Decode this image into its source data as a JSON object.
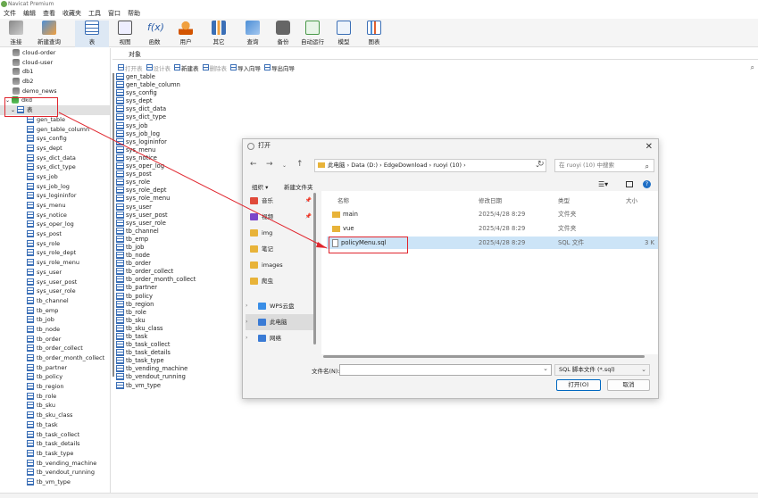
{
  "app": {
    "title": "Navicat Premium"
  },
  "menu": [
    "文件",
    "编辑",
    "查看",
    "收藏夹",
    "工具",
    "窗口",
    "帮助"
  ],
  "toolbar": {
    "buttons": [
      {
        "label": "连接",
        "icon": "plug-icon"
      },
      {
        "label": "新建查询",
        "icon": "new-query-icon"
      },
      {
        "label": "表",
        "icon": "table-icon"
      },
      {
        "label": "视图",
        "icon": "view-icon"
      },
      {
        "label": "函数",
        "icon": "function-icon"
      },
      {
        "label": "用户",
        "icon": "user-icon"
      },
      {
        "label": "其它",
        "icon": "tools-icon"
      },
      {
        "label": "查询",
        "icon": "query-icon"
      },
      {
        "label": "备份",
        "icon": "backup-icon"
      },
      {
        "label": "自动运行",
        "icon": "schedule-icon"
      },
      {
        "label": "模型",
        "icon": "model-icon"
      },
      {
        "label": "图表",
        "icon": "chart-icon"
      }
    ]
  },
  "sidebar": {
    "databases_top": [
      "cloud-order",
      "cloud-user",
      "db1",
      "db2",
      "demo_news"
    ],
    "active_db": "dkd",
    "tables_node": "表",
    "tables": [
      "gen_table",
      "gen_table_column",
      "sys_config",
      "sys_dept",
      "sys_dict_data",
      "sys_dict_type",
      "sys_job",
      "sys_job_log",
      "sys_logininfor",
      "sys_menu",
      "sys_notice",
      "sys_oper_log",
      "sys_post",
      "sys_role",
      "sys_role_dept",
      "sys_role_menu",
      "sys_user",
      "sys_user_post",
      "sys_user_role",
      "tb_channel",
      "tb_emp",
      "tb_job",
      "tb_node",
      "tb_order",
      "tb_order_collect",
      "tb_order_month_collect",
      "tb_partner",
      "tb_policy",
      "tb_region",
      "tb_role",
      "tb_sku",
      "tb_sku_class",
      "tb_task",
      "tb_task_collect",
      "tb_task_details",
      "tb_task_type",
      "tb_vending_machine",
      "tb_vendout_running",
      "tb_vm_type"
    ]
  },
  "objects": {
    "tab": "对象",
    "toolbar": {
      "open": "打开表",
      "design": "设计表",
      "new": "新建表",
      "delete": "删除表",
      "import": "导入向导",
      "export": "导出向导"
    },
    "list": [
      "gen_table",
      "gen_table_column",
      "sys_config",
      "sys_dept",
      "sys_dict_data",
      "sys_dict_type",
      "sys_job",
      "sys_job_log",
      "sys_logininfor",
      "sys_menu",
      "sys_notice",
      "sys_oper_log",
      "sys_post",
      "sys_role",
      "sys_role_dept",
      "sys_role_menu",
      "sys_user",
      "sys_user_post",
      "sys_user_role",
      "tb_channel",
      "tb_emp",
      "tb_job",
      "tb_node",
      "tb_order",
      "tb_order_collect",
      "tb_order_month_collect",
      "tb_partner",
      "tb_policy",
      "tb_region",
      "tb_role",
      "tb_sku",
      "tb_sku_class",
      "tb_task",
      "tb_task_collect",
      "tb_task_details",
      "tb_task_type",
      "tb_vending_machine",
      "tb_vendout_running",
      "tb_vm_type"
    ]
  },
  "dialog": {
    "title": "打开",
    "breadcrumb": "此电脑 › Data (D:) › EdgeDownload › ruoyi (10) ›",
    "search_placeholder": "在 ruoyi (10) 中搜索",
    "organize": "组织 ▾",
    "new_folder": "新建文件夹",
    "nav": [
      {
        "label": "音乐",
        "pinned": true,
        "color": "#e04a3a"
      },
      {
        "label": "视频",
        "pinned": true,
        "color": "#7b45c9"
      },
      {
        "label": "img",
        "pinned": false,
        "color": "#e8b339"
      },
      {
        "label": "笔记",
        "pinned": false,
        "color": "#e8b339"
      },
      {
        "label": "images",
        "pinned": false,
        "color": "#e8b339"
      },
      {
        "label": "爬虫",
        "pinned": false,
        "color": "#e8b339"
      }
    ],
    "nav_lower": [
      {
        "label": "WPS云盘",
        "color": "#3a8ee6"
      },
      {
        "label": "此电脑",
        "color": "#3a7bd5"
      },
      {
        "label": "网络",
        "color": "#3a7bd5"
      }
    ],
    "columns": {
      "name": "名称",
      "modified": "修改日期",
      "type": "类型",
      "size": "大小"
    },
    "files": [
      {
        "name": "main",
        "modified": "2025/4/28 8:29",
        "type": "文件夹",
        "size": "",
        "kind": "folder"
      },
      {
        "name": "vue",
        "modified": "2025/4/28 8:29",
        "type": "文件夹",
        "size": "",
        "kind": "folder"
      },
      {
        "name": "policyMenu.sql",
        "modified": "2025/4/28 8:29",
        "type": "SQL 文件",
        "size": "3 K",
        "kind": "sql"
      }
    ],
    "filename_label": "文件名(N):",
    "filename_value": "",
    "filetype": "SQL 脚本文件 (*.sql)",
    "open_button": "打开(O)",
    "cancel_button": "取消"
  },
  "colors": {
    "highlight": "#e0262e",
    "selection": "#cce4f7",
    "accent": "#0067c0"
  }
}
